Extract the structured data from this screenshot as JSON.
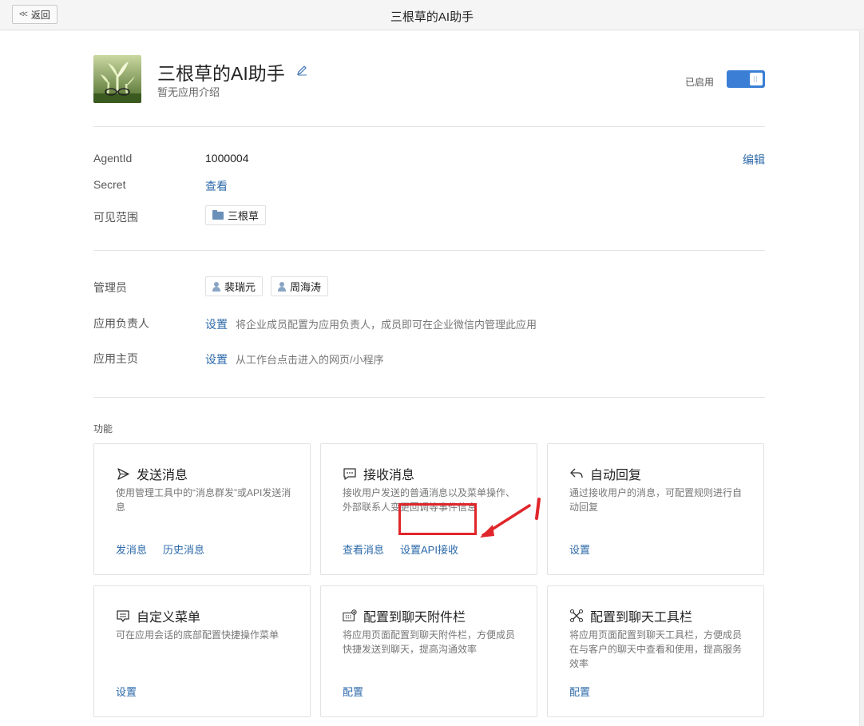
{
  "window": {
    "title": "三根草的AI助手",
    "back_label": "返回"
  },
  "app": {
    "name": "三根草的AI助手",
    "description": "暂无应用介绍",
    "status_label": "已启用",
    "enabled": true
  },
  "info": {
    "agentid_label": "AgentId",
    "agentid_value": "1000004",
    "edit_label": "编辑",
    "secret_label": "Secret",
    "secret_value": "查看",
    "scope_label": "可见范围",
    "scope_tag": "三根草"
  },
  "admins": {
    "label": "管理员",
    "people": [
      "裴瑞元",
      "周海涛"
    ]
  },
  "owner": {
    "label": "应用负责人",
    "action": "设置",
    "hint": "将企业成员配置为应用负责人，成员即可在企业微信内管理此应用"
  },
  "homepage": {
    "label": "应用主页",
    "action": "设置",
    "hint": "从工作台点击进入的网页/小程序"
  },
  "features": {
    "section_title": "功能",
    "cards": [
      {
        "title": "发送消息",
        "icon": "send-icon",
        "desc": "使用管理工具中的“消息群发”或API发送消息",
        "actions": [
          "发消息",
          "历史消息"
        ]
      },
      {
        "title": "接收消息",
        "icon": "chat-icon",
        "desc": "接收用户发送的普通消息以及菜单操作、外部联系人变更回调等事件信息",
        "actions": [
          "查看消息",
          "设置API接收"
        ]
      },
      {
        "title": "自动回复",
        "icon": "reply-icon",
        "desc": "通过接收用户的消息，可配置规则进行自动回复",
        "actions": [
          "设置"
        ]
      },
      {
        "title": "自定义菜单",
        "icon": "menu-icon",
        "desc": "可在应用会话的底部配置快捷操作菜单",
        "actions": [
          "设置"
        ]
      },
      {
        "title": "配置到聊天附件栏",
        "icon": "attachment-bar-icon",
        "desc": "将应用页面配置到聊天附件栏，方便成员快捷发送到聊天，提高沟通效率",
        "actions": [
          "配置"
        ]
      },
      {
        "title": "配置到聊天工具栏",
        "icon": "toolbar-icon",
        "desc": "将应用页面配置到聊天工具栏，方便成员在与客户的聊天中查看和使用，提高服务效率",
        "actions": [
          "配置"
        ]
      }
    ]
  },
  "colors": {
    "link": "#2d6aaa",
    "toggle": "#3a7fd5",
    "annotation": "#e0262b"
  }
}
